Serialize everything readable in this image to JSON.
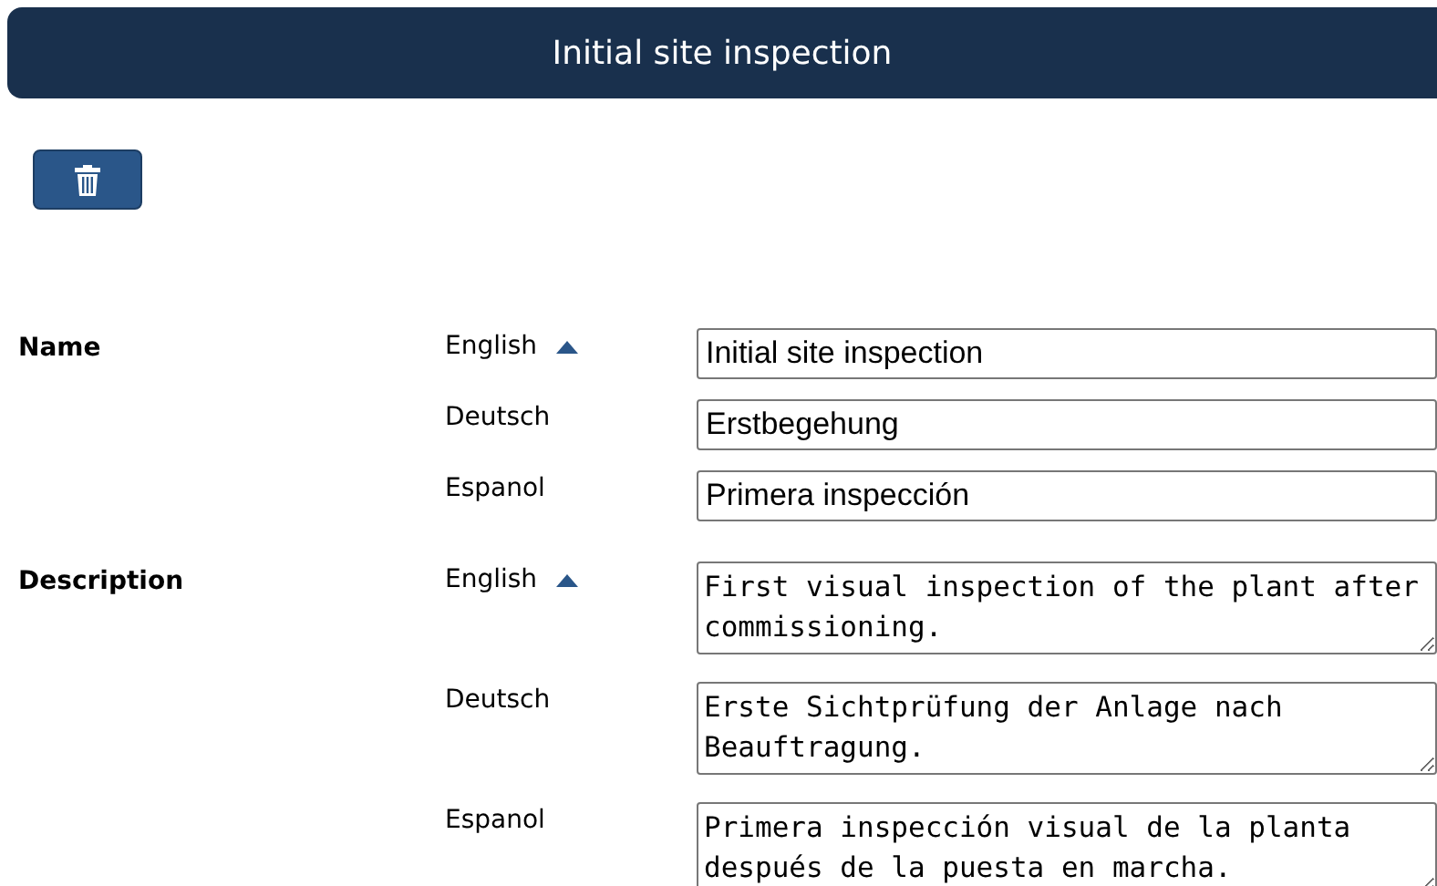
{
  "header": {
    "title": "Initial site inspection"
  },
  "fields": [
    {
      "label": "Name",
      "kind": "input",
      "expanded": true,
      "translations": [
        {
          "language": "English",
          "value": "Initial site inspection"
        },
        {
          "language": "Deutsch",
          "value": "Erstbegehung"
        },
        {
          "language": "Espanol",
          "value": "Primera inspección"
        }
      ]
    },
    {
      "label": "Description",
      "kind": "textarea",
      "expanded": true,
      "translations": [
        {
          "language": "English",
          "value": "First visual inspection of the plant after commissioning."
        },
        {
          "language": "Deutsch",
          "value": "Erste Sichtprüfung der Anlage nach Beauftragung."
        },
        {
          "language": "Espanol",
          "value": "Primera inspección visual de la planta después de la puesta en marcha."
        }
      ]
    }
  ]
}
